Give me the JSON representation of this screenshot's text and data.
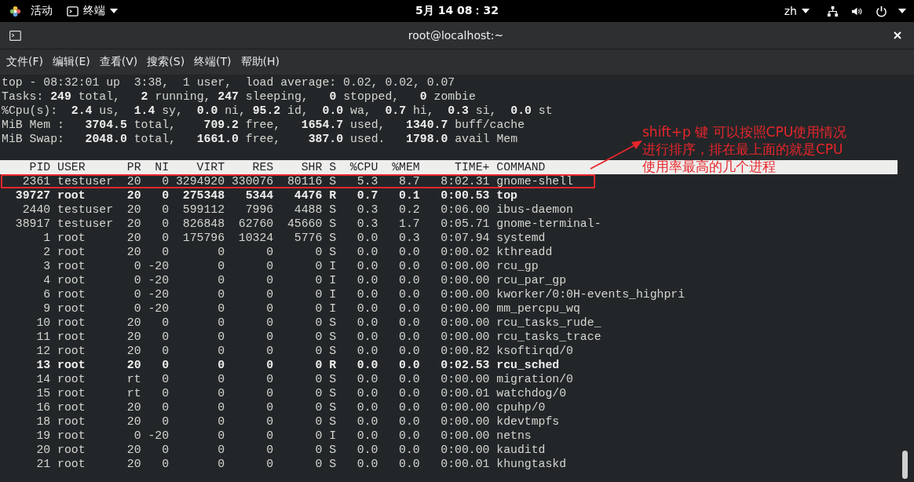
{
  "top_bar": {
    "activities": "活动",
    "app_menu": "终端",
    "clock": "5月 14 08：32",
    "language": "zh"
  },
  "window": {
    "title": "root@localhost:~"
  },
  "menu": [
    "文件(F)",
    "编辑(E)",
    "查看(V)",
    "搜索(S)",
    "终端(T)",
    "帮助(H)"
  ],
  "summary": [
    "top - 08:32:01 up  3:38,  1 user,  load average: 0.02, 0.02, 0.07",
    "Tasks: **249** total,   **2** running, **247** sleeping,   **0** stopped,   **0** zombie",
    "%Cpu(s):  **2.4** us,  **1.4** sy,  **0.0** ni, **95.2** id,  **0.0** wa,  **0.7** hi,  **0.3** si,  **0.0** st",
    "MiB Mem :   **3704.5** total,    **709.2** free,   **1654.7** used,   **1340.7** buff/cache",
    "MiB Swap:   **2048.0** total,   **1661.0** free,    **387.0** used.   **1798.0** avail Mem"
  ],
  "table": {
    "columns": [
      "PID",
      "USER",
      "PR",
      "NI",
      "VIRT",
      "RES",
      "SHR",
      "S",
      "%CPU",
      "%MEM",
      "TIME+",
      "COMMAND"
    ],
    "rows": [
      {
        "cells": [
          "2361",
          "testuser",
          "20",
          "0",
          "3294920",
          "330076",
          "80116",
          "S",
          "5.3",
          "8.7",
          "8:02.31",
          "gnome-shell"
        ],
        "bold": false,
        "boxed": true
      },
      {
        "cells": [
          "39727",
          "root",
          "20",
          "0",
          "275348",
          "5344",
          "4476",
          "R",
          "0.7",
          "0.1",
          "0:00.53",
          "top"
        ],
        "bold": true,
        "boxed": false
      },
      {
        "cells": [
          "2440",
          "testuser",
          "20",
          "0",
          "599112",
          "7996",
          "4488",
          "S",
          "0.3",
          "0.2",
          "0:06.00",
          "ibus-daemon"
        ],
        "bold": false,
        "boxed": false
      },
      {
        "cells": [
          "38917",
          "testuser",
          "20",
          "0",
          "826848",
          "62760",
          "45660",
          "S",
          "0.3",
          "1.7",
          "0:05.71",
          "gnome-terminal-"
        ],
        "bold": false,
        "boxed": false
      },
      {
        "cells": [
          "1",
          "root",
          "20",
          "0",
          "175796",
          "10324",
          "5776",
          "S",
          "0.0",
          "0.3",
          "0:07.94",
          "systemd"
        ],
        "bold": false,
        "boxed": false
      },
      {
        "cells": [
          "2",
          "root",
          "20",
          "0",
          "0",
          "0",
          "0",
          "S",
          "0.0",
          "0.0",
          "0:00.02",
          "kthreadd"
        ],
        "bold": false,
        "boxed": false
      },
      {
        "cells": [
          "3",
          "root",
          "0",
          "-20",
          "0",
          "0",
          "0",
          "I",
          "0.0",
          "0.0",
          "0:00.00",
          "rcu_gp"
        ],
        "bold": false,
        "boxed": false
      },
      {
        "cells": [
          "4",
          "root",
          "0",
          "-20",
          "0",
          "0",
          "0",
          "I",
          "0.0",
          "0.0",
          "0:00.00",
          "rcu_par_gp"
        ],
        "bold": false,
        "boxed": false
      },
      {
        "cells": [
          "6",
          "root",
          "0",
          "-20",
          "0",
          "0",
          "0",
          "I",
          "0.0",
          "0.0",
          "0:00.00",
          "kworker/0:0H-events_highpri"
        ],
        "bold": false,
        "boxed": false
      },
      {
        "cells": [
          "9",
          "root",
          "0",
          "-20",
          "0",
          "0",
          "0",
          "I",
          "0.0",
          "0.0",
          "0:00.00",
          "mm_percpu_wq"
        ],
        "bold": false,
        "boxed": false
      },
      {
        "cells": [
          "10",
          "root",
          "20",
          "0",
          "0",
          "0",
          "0",
          "S",
          "0.0",
          "0.0",
          "0:00.00",
          "rcu_tasks_rude_"
        ],
        "bold": false,
        "boxed": false
      },
      {
        "cells": [
          "11",
          "root",
          "20",
          "0",
          "0",
          "0",
          "0",
          "S",
          "0.0",
          "0.0",
          "0:00.00",
          "rcu_tasks_trace"
        ],
        "bold": false,
        "boxed": false
      },
      {
        "cells": [
          "12",
          "root",
          "20",
          "0",
          "0",
          "0",
          "0",
          "S",
          "0.0",
          "0.0",
          "0:00.82",
          "ksoftirqd/0"
        ],
        "bold": false,
        "boxed": false
      },
      {
        "cells": [
          "13",
          "root",
          "20",
          "0",
          "0",
          "0",
          "0",
          "R",
          "0.0",
          "0.0",
          "0:02.53",
          "rcu_sched"
        ],
        "bold": true,
        "boxed": false
      },
      {
        "cells": [
          "14",
          "root",
          "rt",
          "0",
          "0",
          "0",
          "0",
          "S",
          "0.0",
          "0.0",
          "0:00.00",
          "migration/0"
        ],
        "bold": false,
        "boxed": false
      },
      {
        "cells": [
          "15",
          "root",
          "rt",
          "0",
          "0",
          "0",
          "0",
          "S",
          "0.0",
          "0.0",
          "0:00.01",
          "watchdog/0"
        ],
        "bold": false,
        "boxed": false
      },
      {
        "cells": [
          "16",
          "root",
          "20",
          "0",
          "0",
          "0",
          "0",
          "S",
          "0.0",
          "0.0",
          "0:00.00",
          "cpuhp/0"
        ],
        "bold": false,
        "boxed": false
      },
      {
        "cells": [
          "18",
          "root",
          "20",
          "0",
          "0",
          "0",
          "0",
          "S",
          "0.0",
          "0.0",
          "0:00.00",
          "kdevtmpfs"
        ],
        "bold": false,
        "boxed": false
      },
      {
        "cells": [
          "19",
          "root",
          "0",
          "-20",
          "0",
          "0",
          "0",
          "I",
          "0.0",
          "0.0",
          "0:00.00",
          "netns"
        ],
        "bold": false,
        "boxed": false
      },
      {
        "cells": [
          "20",
          "root",
          "20",
          "0",
          "0",
          "0",
          "0",
          "S",
          "0.0",
          "0.0",
          "0:00.00",
          "kauditd"
        ],
        "bold": false,
        "boxed": false
      },
      {
        "cells": [
          "21",
          "root",
          "20",
          "0",
          "0",
          "0",
          "0",
          "S",
          "0.0",
          "0.0",
          "0:00.01",
          "khungtaskd"
        ],
        "bold": false,
        "boxed": false
      }
    ]
  },
  "annotation": {
    "lines": [
      "shift+p 键 可以按照CPU使用情况",
      "进行排序，排在最上面的就是CPU",
      "使用率最高的几个进程"
    ]
  }
}
